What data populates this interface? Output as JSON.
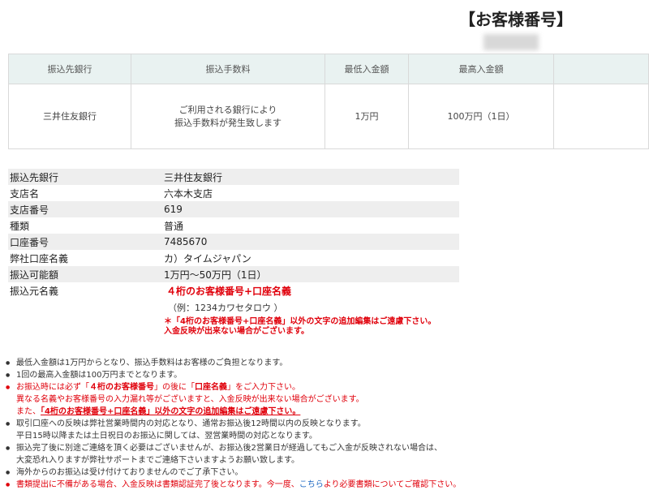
{
  "header": {
    "customer_number_title": "【お客様番号】"
  },
  "fee_table": {
    "headers": [
      "振込先銀行",
      "振込手数料",
      "最低入金額",
      "最高入金額"
    ],
    "row": {
      "bank": "三井住友銀行",
      "fee_line1": "ご利用される銀行により",
      "fee_line2": "振込手数料が発生致します",
      "min": "1万円",
      "max": "100万円（1日）"
    }
  },
  "bank_info": [
    {
      "label": "振込先銀行",
      "value": "三井住友銀行"
    },
    {
      "label": "支店名",
      "value": "六本木支店"
    },
    {
      "label": "支店番号",
      "value": "619"
    },
    {
      "label": "種類",
      "value": "普通"
    },
    {
      "label": "口座番号",
      "value": "7485670"
    },
    {
      "label": "弊社口座名義",
      "value": "カ）タイムジャパン"
    },
    {
      "label": "振込可能額",
      "value": "1万円〜50万円（1日）"
    },
    {
      "label": "振込元名義",
      "value": ""
    }
  ],
  "remitter_note": {
    "main": "４桁のお客様番号+口座名義",
    "example": "（例：1234カワセタロウ ）",
    "warning_line1": "＊「4桁のお客様番号+口座名義」以外の文字の追加編集はご遠慮下さい。",
    "warning_line2": "入金反映が出来ない場合がございます。"
  },
  "notes": {
    "b1": "最低入金額は1万円からとなり、振込手数料はお客様のご負担となります。",
    "b2": "1回の最高入金額は100万円までとなります。",
    "b3_pre": "お振込時には必ず「",
    "b3_bold": "４桁のお客様番号",
    "b3_mid": "」の後に「",
    "b3_bold2": "口座名義",
    "b3_post": "」をご入力下さい。",
    "b3_line2": "異なる名義やお客様番号の入力漏れ等がございますと、入金反映が出来ない場合がございます。",
    "b3_line3_pre": "また、",
    "b3_line3_ul": "「4桁のお客様番号+口座名義」以外の文字の追加編集はご遠慮下さい。",
    "b4_line1": "取引口座への反映は弊社営業時間内の対応となり、通常お振込後12時間以内の反映となります。",
    "b4_line2": "平日15時以降または土日祝日のお振込に関しては、翌営業時間の対応となります。",
    "b5_line1": "振込完了後に別途ご連絡を頂く必要はございませんが、お振込後2営業日が経過してもご入金が反映されない場合は、",
    "b5_line2": "大変恐れ入りますが弊社サポートまでご連絡下さいますようお願い致します。",
    "b6": "海外からのお振込は受け付けておりませんのでご了承下さい。",
    "b7_pre": "書類提出に不備がある場合、入金反映は書類認証完了後となります。今一度、",
    "b7_link": "こちら",
    "b7_post": "より必要書類についてご確認下さい。"
  }
}
